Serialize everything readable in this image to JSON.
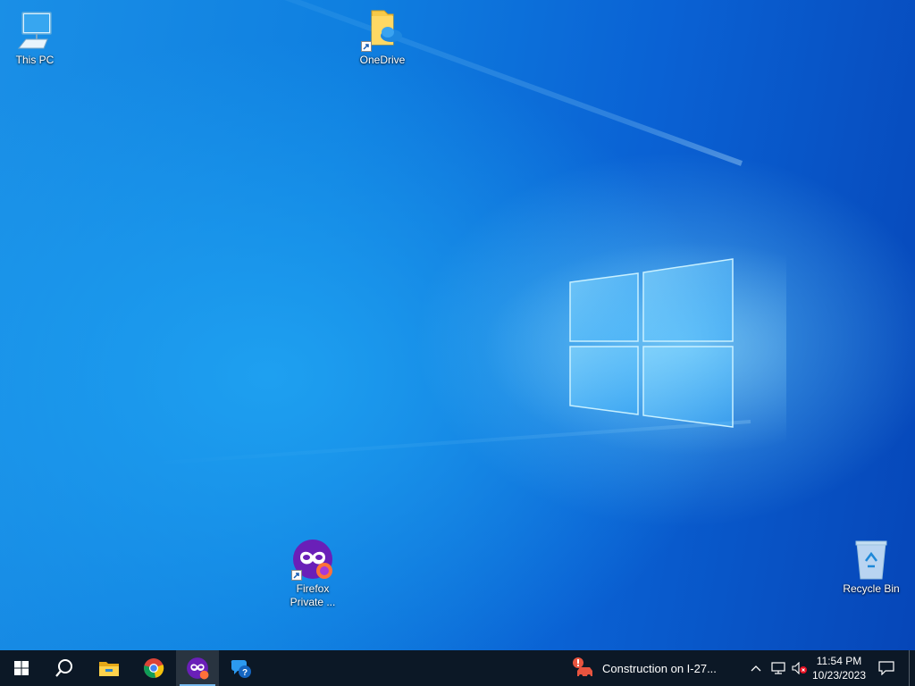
{
  "desktop": {
    "icons": [
      {
        "label": "This PC",
        "icon": "computer-icon"
      },
      {
        "label": "OneDrive",
        "icon": "onedrive-folder-icon"
      },
      {
        "label": "Firefox Private ...",
        "icon": "firefox-private-icon"
      },
      {
        "label": "Recycle Bin",
        "icon": "recycle-bin-icon"
      }
    ],
    "wallpaper": "windows-10-hero",
    "accent": "#0f7fe0"
  },
  "taskbar": {
    "start": {
      "icon": "windows-start-icon"
    },
    "search": {
      "icon": "search-icon"
    },
    "pinned": [
      {
        "name": "File Explorer",
        "icon": "file-explorer-icon"
      },
      {
        "name": "Google Chrome",
        "icon": "chrome-icon"
      },
      {
        "name": "Firefox Private Browsing",
        "icon": "firefox-private-icon",
        "active": true
      },
      {
        "name": "Get Help",
        "icon": "get-help-icon"
      }
    ],
    "news": {
      "text": "Construction on I-27...",
      "icon": "traffic-alert-icon"
    },
    "tray": {
      "chevron": "chevron-up-icon",
      "network": "network-icon",
      "volume": "volume-muted-icon"
    },
    "clock": {
      "time": "11:54 PM",
      "date": "10/23/2023"
    },
    "notifications": {
      "icon": "notification-icon"
    },
    "background": "#0c1826"
  }
}
